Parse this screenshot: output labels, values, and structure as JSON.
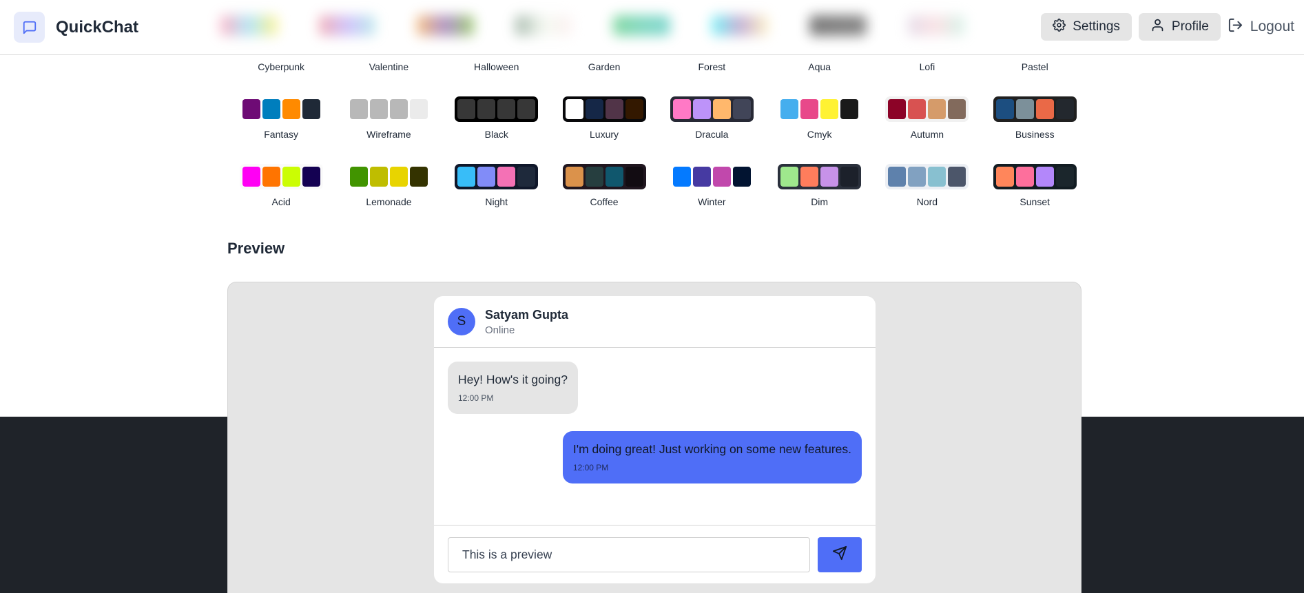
{
  "app": {
    "name": "QuickChat"
  },
  "nav": {
    "settings_label": "Settings",
    "profile_label": "Profile",
    "logout_label": "Logout",
    "icons": {
      "logo": "chat-bubble-icon",
      "settings": "gear-icon",
      "profile": "user-icon",
      "logout": "logout-icon"
    }
  },
  "themes": [
    {
      "name": "Cyberpunk",
      "colors": []
    },
    {
      "name": "Valentine",
      "colors": []
    },
    {
      "name": "Halloween",
      "colors": []
    },
    {
      "name": "Garden",
      "colors": []
    },
    {
      "name": "Forest",
      "colors": []
    },
    {
      "name": "Aqua",
      "colors": []
    },
    {
      "name": "Lofi",
      "colors": []
    },
    {
      "name": "Pastel",
      "colors": []
    },
    {
      "name": "Fantasy",
      "colors": [
        "#6e0b75",
        "#007ebd",
        "#ff8a00",
        "#1f2937"
      ],
      "bg": "#ffffff"
    },
    {
      "name": "Wireframe",
      "colors": [
        "#b8b8b8",
        "#b8b8b8",
        "#b8b8b8",
        "#ebebeb"
      ],
      "bg": "#ffffff"
    },
    {
      "name": "Black",
      "colors": [
        "#373737",
        "#373737",
        "#373737",
        "#373737"
      ],
      "bg": "#000000"
    },
    {
      "name": "Luxury",
      "colors": [
        "#ffffff",
        "#152747",
        "#513448",
        "#331800"
      ],
      "bg": "#09090b"
    },
    {
      "name": "Dracula",
      "colors": [
        "#ff79c6",
        "#bd93f9",
        "#ffb86c",
        "#414558"
      ],
      "bg": "#272935"
    },
    {
      "name": "Cmyk",
      "colors": [
        "#45aeee",
        "#e8488a",
        "#fff232",
        "#1a1a1a"
      ],
      "bg": "#ffffff"
    },
    {
      "name": "Autumn",
      "colors": [
        "#8c0327",
        "#d85251",
        "#d59b6a",
        "#826a5c"
      ],
      "bg": "#f1f1f1"
    },
    {
      "name": "Business",
      "colors": [
        "#1c4e80",
        "#7c909a",
        "#ea6947",
        "#23282e"
      ],
      "bg": "#202020"
    },
    {
      "name": "Acid",
      "colors": [
        "#ff00f4",
        "#ff7400",
        "#cbfd03",
        "#140152"
      ],
      "bg": "#fafafa"
    },
    {
      "name": "Lemonade",
      "colors": [
        "#419400",
        "#bfbd00",
        "#e8d400",
        "#343300"
      ],
      "bg": "#ffffff"
    },
    {
      "name": "Night",
      "colors": [
        "#38bdf8",
        "#818cf8",
        "#f471b5",
        "#1e293b"
      ],
      "bg": "#0f172a"
    },
    {
      "name": "Coffee",
      "colors": [
        "#db924b",
        "#263e3f",
        "#10576d",
        "#120c12"
      ],
      "bg": "#20161f"
    },
    {
      "name": "Winter",
      "colors": [
        "#047aff",
        "#463aa2",
        "#c148ac",
        "#021431"
      ],
      "bg": "#ffffff"
    },
    {
      "name": "Dim",
      "colors": [
        "#9fe88d",
        "#ff7d5c",
        "#c792e9",
        "#1c212b"
      ],
      "bg": "#2a303c"
    },
    {
      "name": "Nord",
      "colors": [
        "#5e81ac",
        "#81a1c1",
        "#88c0d0",
        "#4c566a"
      ],
      "bg": "#eceff4"
    },
    {
      "name": "Sunset",
      "colors": [
        "#ff865b",
        "#fd6f9c",
        "#b387fa",
        "#1b262c"
      ],
      "bg": "#121c22"
    }
  ],
  "preview": {
    "title": "Preview",
    "contact": {
      "initial": "S",
      "name": "Satyam Gupta",
      "status": "Online"
    },
    "messages": [
      {
        "text": "Hey! How's it going?",
        "time": "12:00 PM",
        "sent": false
      },
      {
        "text": "I'm doing great! Just working on some new features.",
        "time": "12:00 PM",
        "sent": true
      }
    ],
    "input_value": "This is a preview",
    "send_icon": "send-icon"
  },
  "colors": {
    "primary": "#4f6ef7",
    "footer_bg": "#1f2329",
    "preview_bg": "#e5e5e5"
  }
}
